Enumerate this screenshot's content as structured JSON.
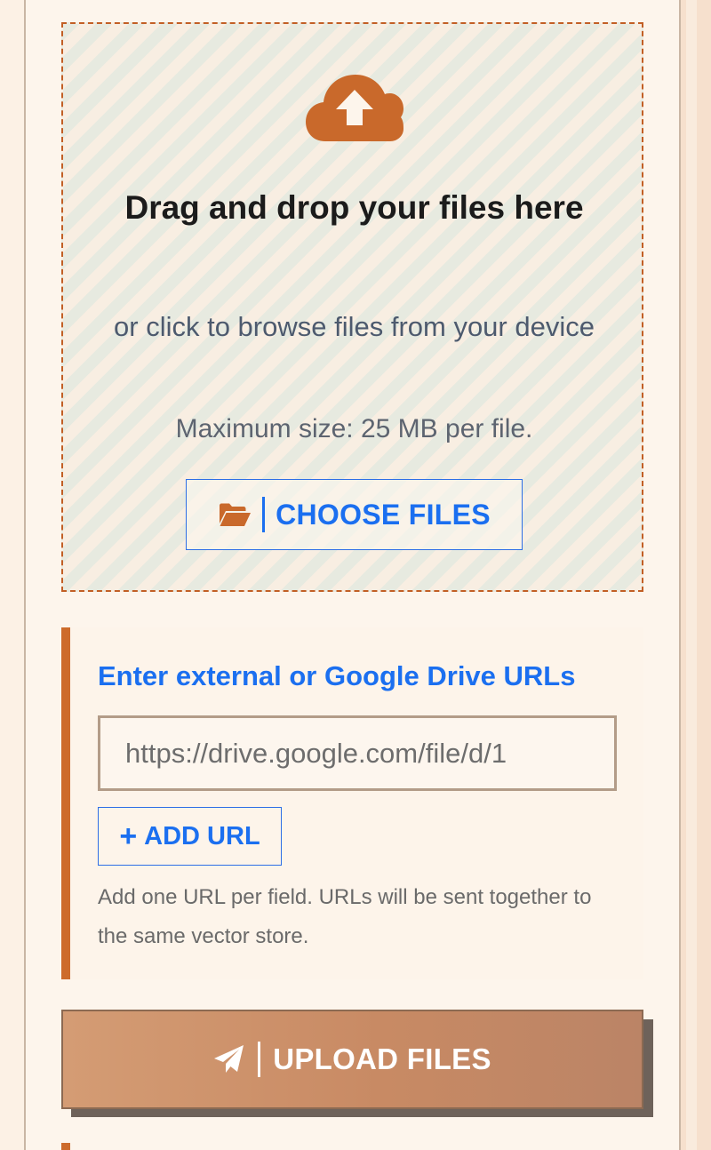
{
  "dropzone": {
    "icon": "cloud-upload-icon",
    "title": "Drag and drop your files here",
    "subtitle": "or click to browse files from your device",
    "max_size": "Maximum size: 25 MB per file.",
    "choose_button": {
      "icon": "folder-open-icon",
      "label": "CHOOSE FILES"
    }
  },
  "url_section": {
    "heading": "Enter external or Google Drive URLs",
    "input_placeholder": "https://drive.google.com/file/d/1",
    "add_button": {
      "icon": "plus-icon",
      "label": "ADD URL"
    },
    "help_text": "Add one URL per field. URLs will be sent together to the same vector store."
  },
  "upload_button": {
    "icon": "paper-plane-icon",
    "label": "UPLOAD FILES"
  },
  "colors": {
    "accent_orange": "#cd6b2b",
    "link_blue": "#1b6ff0",
    "background": "#fcf1e5"
  }
}
